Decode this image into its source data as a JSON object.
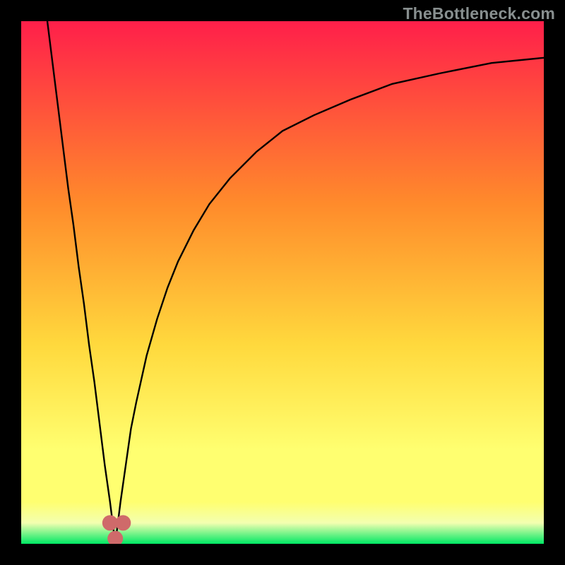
{
  "watermark": "TheBottleneck.com",
  "colors": {
    "frame": "#000000",
    "grad_top": "#ff1f4a",
    "grad_mid1": "#ff8b2b",
    "grad_mid2": "#ffd93d",
    "grad_low": "#ffff70",
    "grad_pale": "#f3ffb0",
    "grad_green": "#00e864",
    "curve": "#000000",
    "marker": "#cf6a6a"
  },
  "chart_data": {
    "type": "line",
    "title": "",
    "xlabel": "",
    "ylabel": "",
    "xlim": [
      0,
      100
    ],
    "ylim": [
      0,
      100
    ],
    "optimum_x": 18,
    "series": [
      {
        "name": "bottleneck-curve",
        "x": [
          5,
          6,
          7,
          8,
          9,
          10,
          11,
          12,
          13,
          14,
          15,
          16,
          17,
          18,
          19,
          20,
          21,
          22,
          24,
          26,
          28,
          30,
          33,
          36,
          40,
          45,
          50,
          56,
          63,
          71,
          80,
          90,
          100
        ],
        "y": [
          100,
          92,
          84,
          76,
          68,
          61,
          53,
          46,
          38,
          31,
          23,
          15,
          8,
          0,
          8,
          15,
          22,
          27,
          36,
          43,
          49,
          54,
          60,
          65,
          70,
          75,
          79,
          82,
          85,
          88,
          90,
          92,
          93
        ]
      }
    ],
    "markers": [
      {
        "name": "opt-left",
        "x": 17,
        "y": 4
      },
      {
        "name": "opt-mid",
        "x": 18,
        "y": 1
      },
      {
        "name": "opt-right",
        "x": 19.5,
        "y": 4
      }
    ]
  }
}
